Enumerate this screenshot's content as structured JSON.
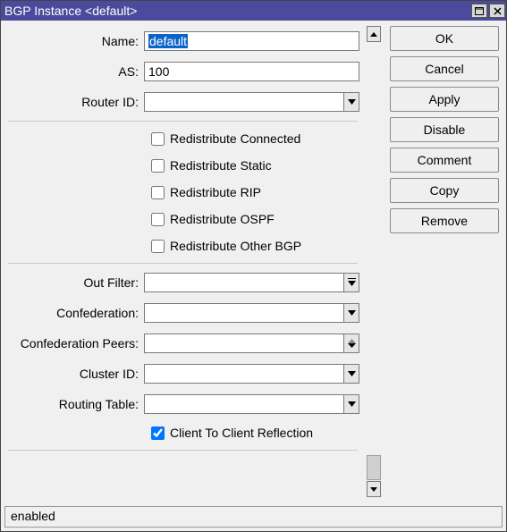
{
  "window": {
    "title": "BGP Instance <default>"
  },
  "side_buttons": {
    "ok": "OK",
    "cancel": "Cancel",
    "apply": "Apply",
    "disable": "Disable",
    "comment": "Comment",
    "copy": "Copy",
    "remove": "Remove"
  },
  "labels": {
    "name": "Name:",
    "as": "AS:",
    "router_id": "Router ID:",
    "out_filter": "Out Filter:",
    "confederation": "Confederation:",
    "confederation_peers": "Confederation Peers:",
    "cluster_id": "Cluster ID:",
    "routing_table": "Routing Table:"
  },
  "values": {
    "name": "default",
    "as": "100",
    "router_id": "",
    "out_filter": "",
    "confederation": "",
    "confederation_peers": "",
    "cluster_id": "",
    "routing_table": ""
  },
  "checkboxes": {
    "redistribute_connected": {
      "label": "Redistribute Connected",
      "checked": false
    },
    "redistribute_static": {
      "label": "Redistribute Static",
      "checked": false
    },
    "redistribute_rip": {
      "label": "Redistribute RIP",
      "checked": false
    },
    "redistribute_ospf": {
      "label": "Redistribute OSPF",
      "checked": false
    },
    "redistribute_other_bgp": {
      "label": "Redistribute Other BGP",
      "checked": false
    },
    "client_to_client": {
      "label": "Client To Client Reflection",
      "checked": true
    }
  },
  "status": "enabled"
}
